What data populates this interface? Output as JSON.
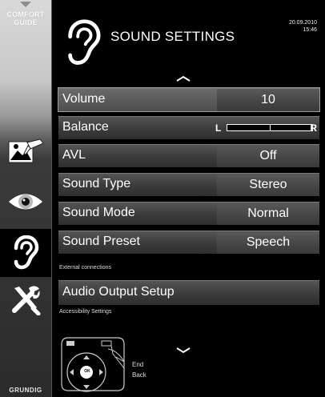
{
  "sidebar": {
    "guide_line1": "COMFORT",
    "guide_line2": "GUIDE",
    "items": [
      {
        "icon": "picture-settings-icon"
      },
      {
        "icon": "eye-icon"
      },
      {
        "icon": "ear-icon"
      },
      {
        "icon": "tools-icon"
      }
    ],
    "active_index": 2,
    "brand": "GRUNDIG"
  },
  "header": {
    "title": "SOUND SETTINGS",
    "date": "20.09.2010",
    "time": "15:46"
  },
  "menu": {
    "rows": [
      {
        "label": "Volume",
        "value": "10"
      },
      {
        "label": "Balance",
        "left": "L",
        "right": "R",
        "balance": 0
      },
      {
        "label": "AVL",
        "value": "Off"
      },
      {
        "label": "Sound Type",
        "value": "Stereo"
      },
      {
        "label": "Sound Mode",
        "value": "Normal"
      },
      {
        "label": "Sound Preset",
        "value": "Speech"
      }
    ],
    "selected_index": 0,
    "external_label": "External connections",
    "audio_output": "Audio Output Setup",
    "accessibility_label": "Accessibility Settings"
  },
  "remote": {
    "ok": "OK",
    "end": "End",
    "back": "Back"
  },
  "colors": {
    "background": "#000000",
    "row": "#404040",
    "value_cell": "#4a4a4a",
    "sidebar_top": "#d9d9d9"
  }
}
